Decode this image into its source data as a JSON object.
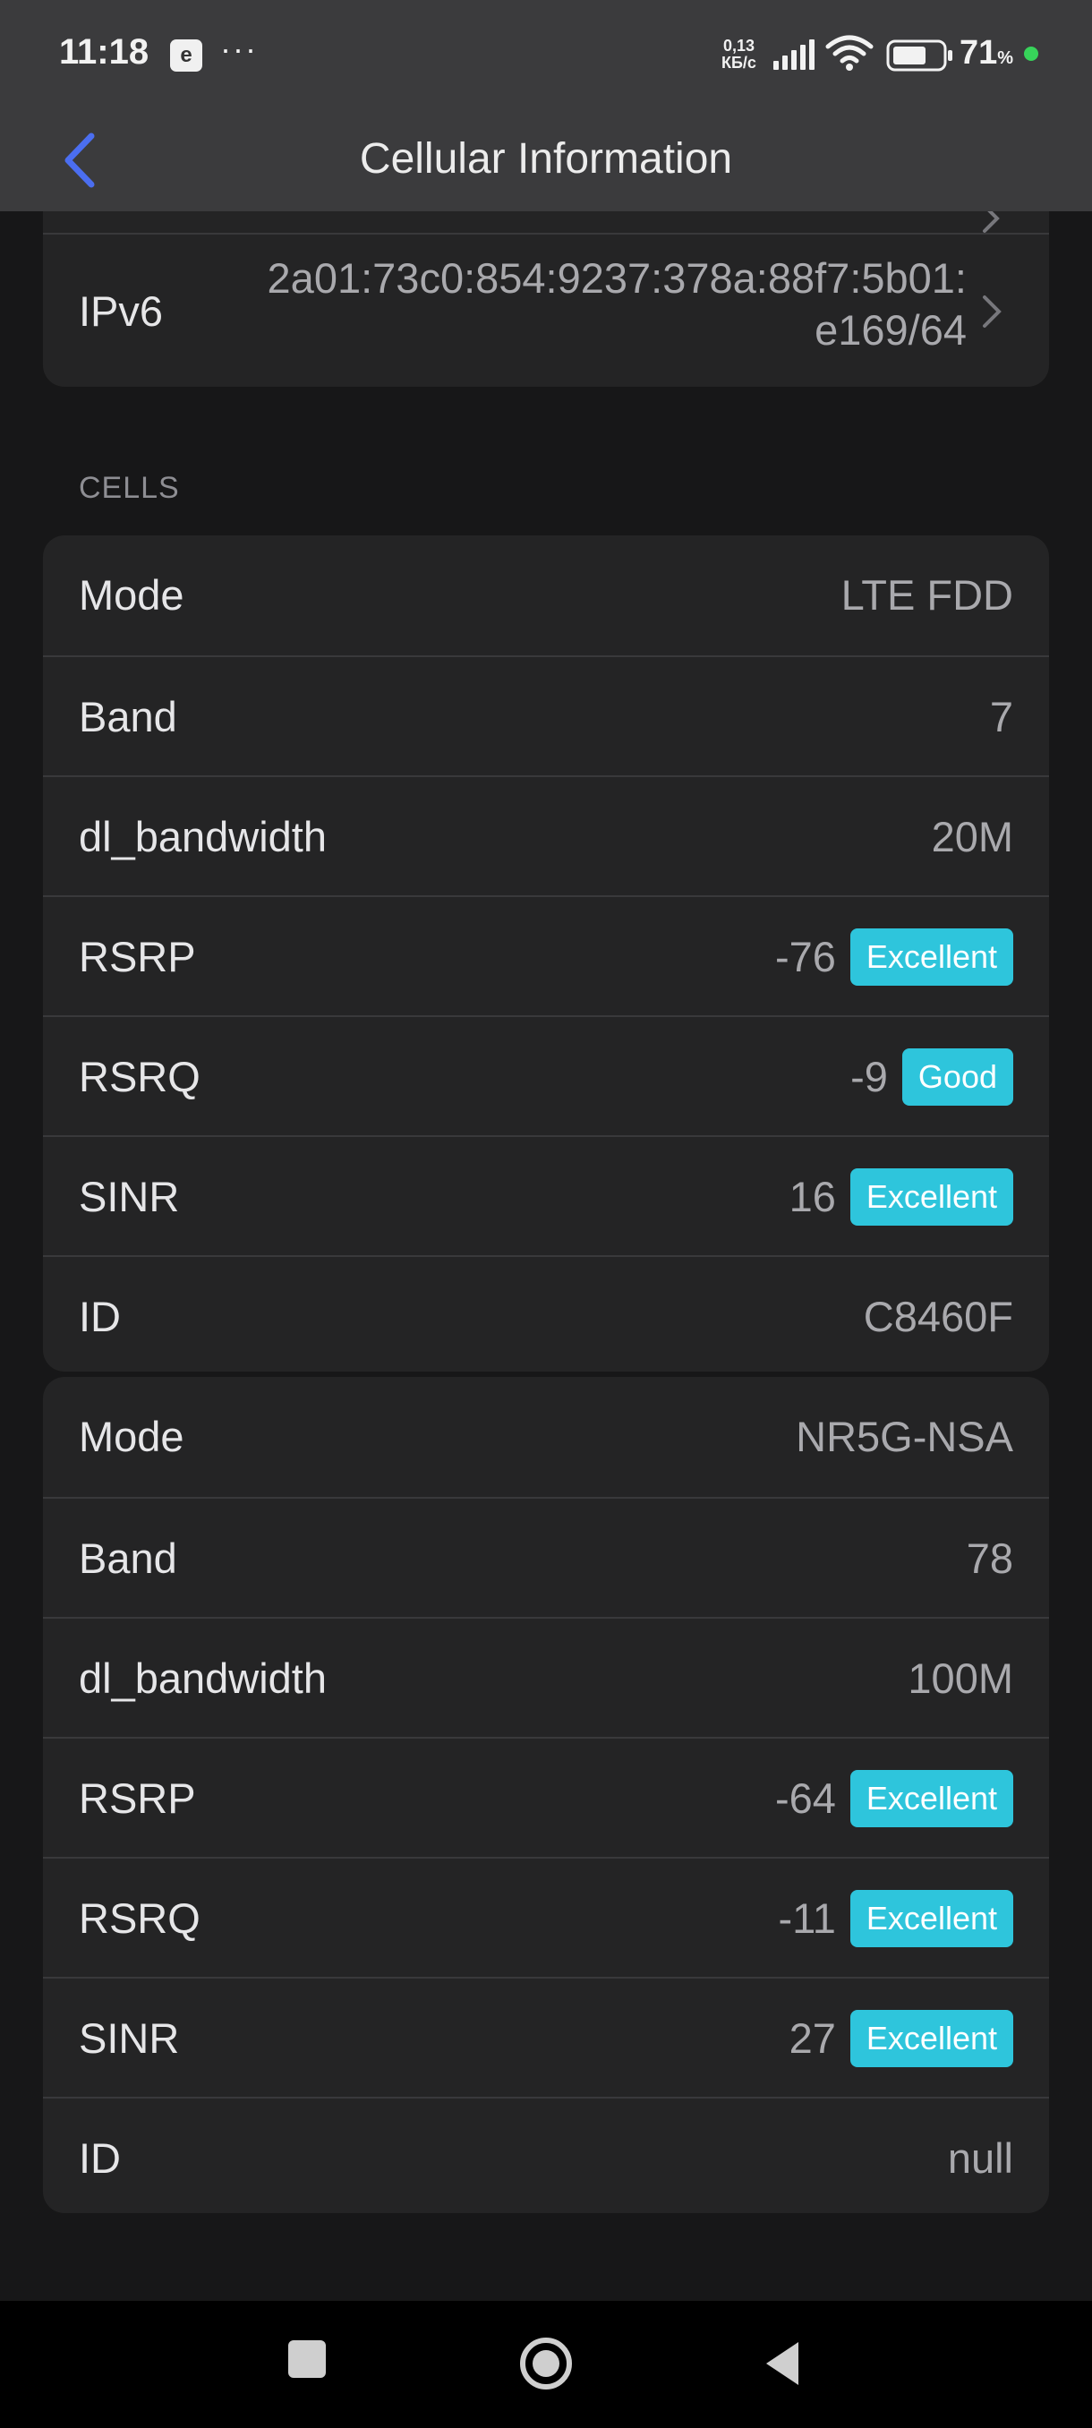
{
  "status_bar": {
    "time": "11:18",
    "notif_letter": "e",
    "more": "···",
    "speed_value": "0,13",
    "speed_unit": "КБ/с",
    "battery_percent": "71",
    "percent_sign": "%"
  },
  "header": {
    "title": "Cellular Information"
  },
  "ipv6": {
    "label": "IPv6",
    "value_line1": "2a01:73c0:854:9237:378a:88f7:5b01:",
    "value_line2": "e169/64"
  },
  "cells_section": {
    "heading": "CELLS"
  },
  "cells": [
    {
      "rows": [
        {
          "label": "Mode",
          "value": "LTE FDD"
        },
        {
          "label": "Band",
          "value": "7"
        },
        {
          "label": "dl_bandwidth",
          "value": "20M"
        },
        {
          "label": "RSRP",
          "value": "-76",
          "badge": "Excellent"
        },
        {
          "label": "RSRQ",
          "value": "-9",
          "badge": "Good"
        },
        {
          "label": "SINR",
          "value": "16",
          "badge": "Excellent"
        },
        {
          "label": "ID",
          "value": "C8460F"
        }
      ]
    },
    {
      "rows": [
        {
          "label": "Mode",
          "value": "NR5G-NSA"
        },
        {
          "label": "Band",
          "value": "78"
        },
        {
          "label": "dl_bandwidth",
          "value": "100M"
        },
        {
          "label": "RSRP",
          "value": "-64",
          "badge": "Excellent"
        },
        {
          "label": "RSRQ",
          "value": "-11",
          "badge": "Excellent"
        },
        {
          "label": "SINR",
          "value": "27",
          "badge": "Excellent"
        },
        {
          "label": "ID",
          "value": "null"
        }
      ]
    }
  ],
  "colors": {
    "badge": "#2ec5dc",
    "accent": "#4b6ef0",
    "background": "#171718"
  }
}
